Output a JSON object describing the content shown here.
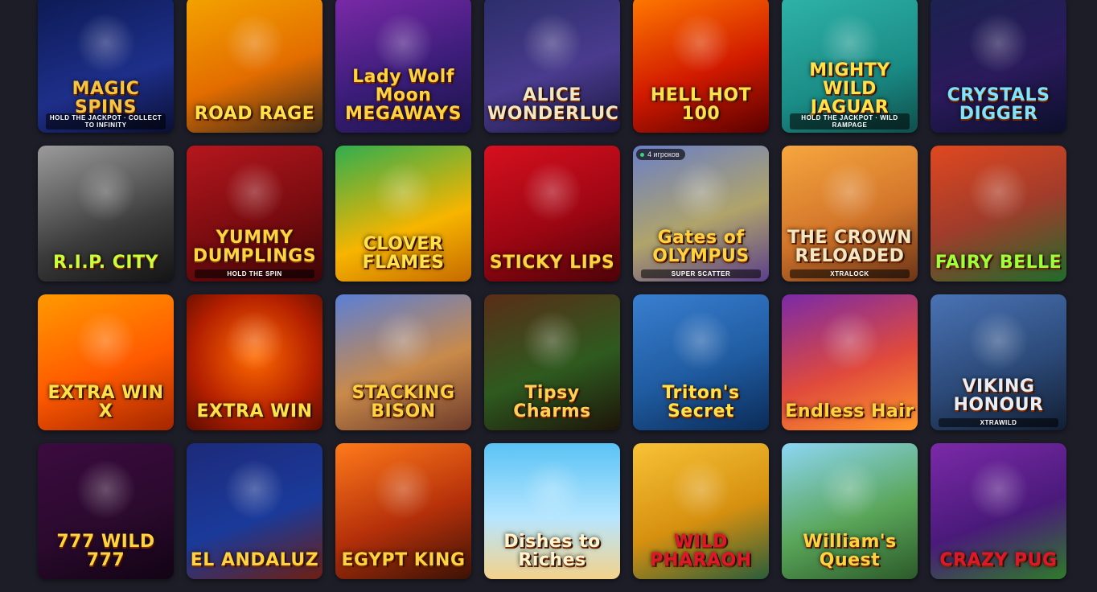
{
  "games": [
    {
      "title": "MAGIC SPINS",
      "subtitle": "HOLD THE JACKPOT · COLLECT TO INFINITY",
      "bg": "linear-gradient(160deg,#0d1a55,#1e2f8a 60%,#0a0f33)",
      "color": "#f5c542"
    },
    {
      "title": "ROAD RAGE",
      "subtitle": "",
      "bg": "linear-gradient(160deg,#f4a300,#e36d00 55%,#3b2a1a)",
      "color": "#ffe14a"
    },
    {
      "title": "Lady Wolf Moon MEGAWAYS",
      "subtitle": "",
      "bg": "linear-gradient(160deg,#7b2aa8,#3c1d7a 55%,#1b1448)",
      "color": "#ffd23f"
    },
    {
      "title": "ALICE WONDERLUCK",
      "subtitle": "",
      "bg": "linear-gradient(160deg,#2b2e6a,#4a3b8e 55%,#1a1740)",
      "color": "#f3e6c2"
    },
    {
      "title": "HELL HOT 100",
      "subtitle": "",
      "bg": "linear-gradient(160deg,#ff7a00,#d11a00 55%,#5a0000)",
      "color": "#ffe14a"
    },
    {
      "title": "MIGHTY WILD JAGUAR",
      "subtitle": "HOLD THE JACKPOT · WILD RAMPAGE",
      "bg": "linear-gradient(160deg,#2fb3a8,#1a8c86 60%,#0f4e4a)",
      "color": "#ffe14a"
    },
    {
      "title": "CRYSTALS DIGGER",
      "subtitle": "",
      "bg": "linear-gradient(160deg,#1b2250,#2b1a5c 55%,#0b0f2a)",
      "color": "#7fe3ff"
    },
    {
      "title": "R.I.P. CITY",
      "subtitle": "",
      "bg": "linear-gradient(160deg,#9b9b9b,#3c3c3c 60%,#141414)",
      "color": "#c8ff3a"
    },
    {
      "title": "YUMMY DUMPLINGS",
      "subtitle": "HOLD THE SPIN",
      "bg": "linear-gradient(160deg,#b5171d,#7a0c10 55%,#3d0507)",
      "color": "#ffd23f"
    },
    {
      "title": "CLOVER FLAMES",
      "subtitle": "",
      "bg": "linear-gradient(160deg,#2fae4f,#f7b500 60%,#c56a00)",
      "color": "#ffe14a"
    },
    {
      "title": "STICKY LIPS",
      "subtitle": "",
      "bg": "linear-gradient(160deg,#d6101f,#9e0613 55%,#4c0308)",
      "color": "#ffd23f"
    },
    {
      "title": "Gates of OLYMPUS",
      "subtitle": "SUPER SCATTER",
      "bg": "linear-gradient(160deg,#6a7fc7,#b0a46a 55%,#5a3f8a)",
      "color": "#ffd23f",
      "players": "4 игроков"
    },
    {
      "title": "THE CROWN RELOADED",
      "subtitle": "XTRALOCK",
      "bg": "linear-gradient(160deg,#f7a63f,#d2752a 55%,#6b3417)",
      "color": "#f3e6c2"
    },
    {
      "title": "FAIRY BELLE",
      "subtitle": "",
      "bg": "linear-gradient(160deg,#e0481f,#a13c2b 50%,#1f6b2b)",
      "color": "#9dff3a"
    },
    {
      "title": "EXTRA WIN X",
      "subtitle": "",
      "bg": "linear-gradient(160deg,#ff9a00,#ff5a00 55%,#a32500)",
      "color": "#ffe14a"
    },
    {
      "title": "EXTRA WIN",
      "subtitle": "",
      "bg": "radial-gradient(circle at 50% 45%,#ff6a00,#b31f00 60%,#5a0c00)",
      "color": "#ffe14a"
    },
    {
      "title": "STACKING BISON",
      "subtitle": "",
      "bg": "linear-gradient(160deg,#5a7fd6,#c98a4a 55%,#6d3a2a)",
      "color": "#ffd23f"
    },
    {
      "title": "Tipsy Charms",
      "subtitle": "",
      "bg": "linear-gradient(160deg,#5a2d17,#2e5a1f 55%,#1d140a)",
      "color": "#ffcf57"
    },
    {
      "title": "Triton's Secret",
      "subtitle": "",
      "bg": "linear-gradient(160deg,#3a7fd1,#1f5ba0 55%,#0b2b57)",
      "color": "#ffe14a"
    },
    {
      "title": "Endless Hair",
      "subtitle": "",
      "bg": "linear-gradient(160deg,#7a2aa8,#e04a3c 55%,#ff9a2a)",
      "color": "#ffd23f"
    },
    {
      "title": "VIKING HONOUR",
      "subtitle": "XTRAWILD",
      "bg": "linear-gradient(160deg,#4a73b5,#2c4a79 55%,#121e33)",
      "color": "#e8eef7"
    },
    {
      "title": "777 WILD 777",
      "subtitle": "",
      "bg": "linear-gradient(160deg,#3b0b3f,#2b0a2e 55%,#120314)",
      "color": "#ffd23f"
    },
    {
      "title": "EL ANDALUZ",
      "subtitle": "",
      "bg": "linear-gradient(160deg,#1d2a7a,#1a3a9a 55%,#6e1f12)",
      "color": "#ffd23f"
    },
    {
      "title": "EGYPT KING",
      "subtitle": "",
      "bg": "linear-gradient(160deg,#ff7a1a,#b5300a 55%,#3b1206)",
      "color": "#ffd23f"
    },
    {
      "title": "Dishes to Riches",
      "subtitle": "",
      "bg": "linear-gradient(180deg,#5ac3f5,#b6e6ff 55%,#f3d28a)",
      "color": "#fff6d1"
    },
    {
      "title": "WILD PHARAOH",
      "subtitle": "",
      "bg": "linear-gradient(160deg,#f7c237,#d6900f 55%,#2a5d3b)",
      "color": "#e0162a"
    },
    {
      "title": "William's Quest",
      "subtitle": "",
      "bg": "linear-gradient(160deg,#8dd6f5,#5aa65a 55%,#2c5a2a)",
      "color": "#ffd23f"
    },
    {
      "title": "CRAZY PUG",
      "subtitle": "",
      "bg": "linear-gradient(160deg,#7b2aa8,#4a1a7a 55%,#2f7a2a)",
      "color": "#e0162a"
    }
  ]
}
